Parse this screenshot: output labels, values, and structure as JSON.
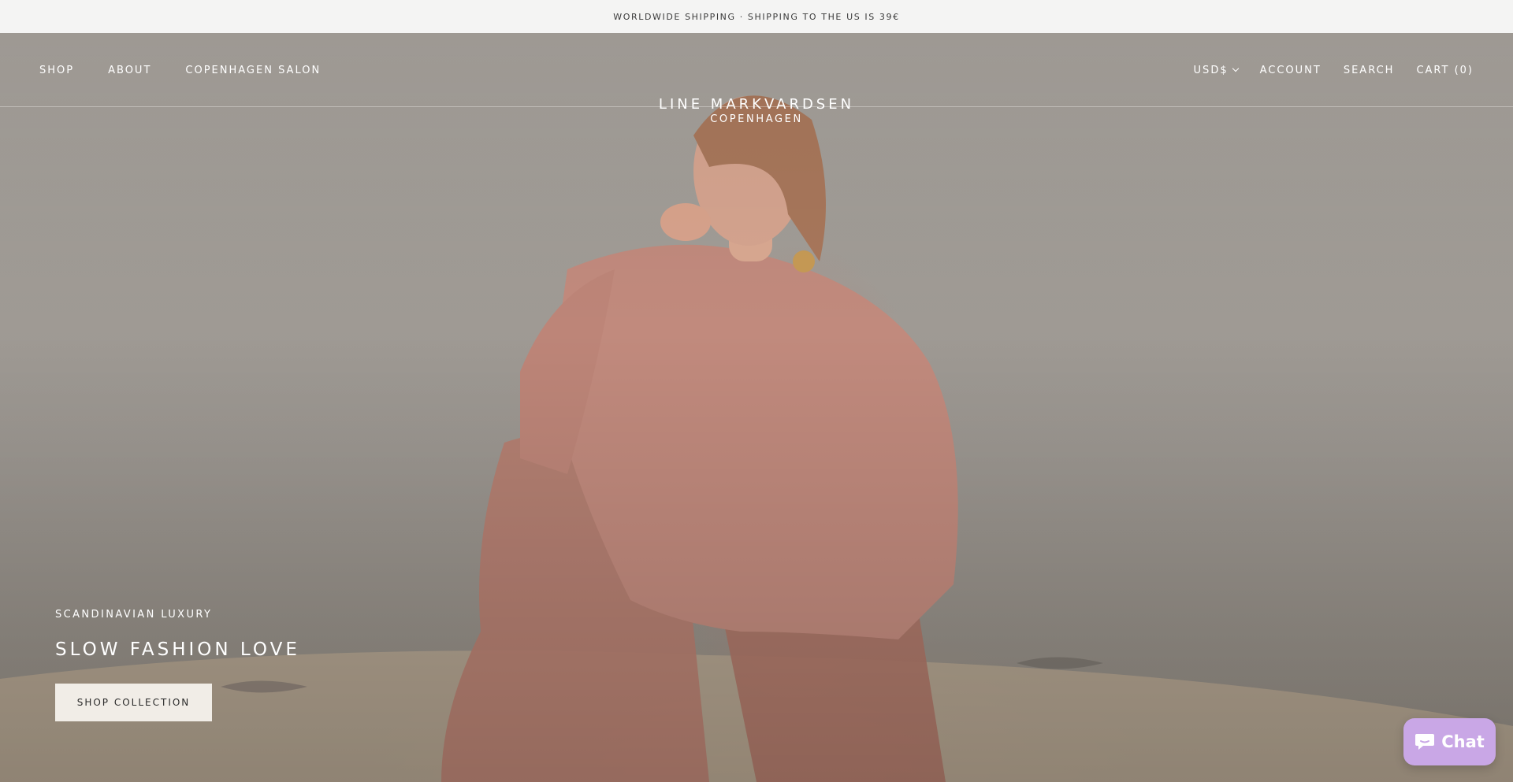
{
  "announcement": {
    "text": "WORLDWIDE SHIPPING · SHIPPING TO THE US IS 39€"
  },
  "header": {
    "nav_left": [
      {
        "label": "SHOP"
      },
      {
        "label": "ABOUT"
      },
      {
        "label": "COPENHAGEN SALON"
      }
    ],
    "logo": {
      "main": "LINE MARKVARDSEN",
      "sub": "COPENHAGEN"
    },
    "currency": "USD$",
    "account": "ACCOUNT",
    "search": "SEARCH",
    "cart": "CART (0)"
  },
  "hero": {
    "eyebrow": "SCANDINAVIAN LUXURY",
    "headline": "SLOW FASHION LOVE",
    "cta": "SHOP COLLECTION"
  },
  "chat": {
    "label": "Chat",
    "icon": "chat-bubble-icon"
  },
  "colors": {
    "announcement_bg": "#f4f4f3",
    "cta_bg": "#f1ede7",
    "chat_bg": "#c9a7e6"
  }
}
